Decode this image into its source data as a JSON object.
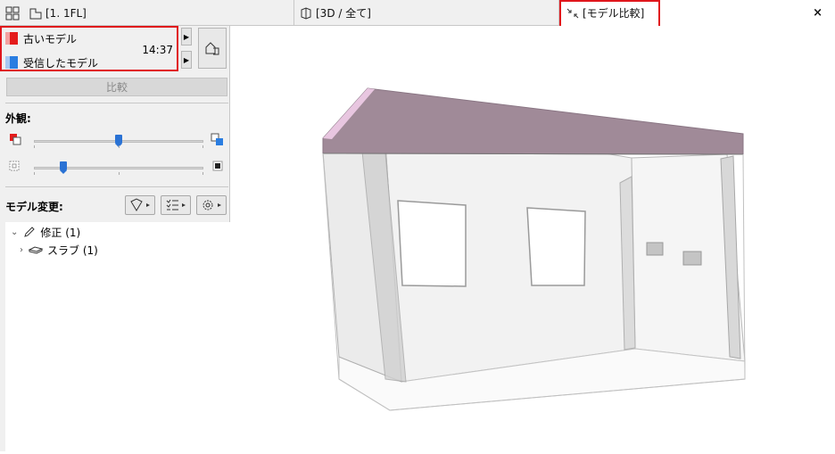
{
  "tabs": [
    {
      "label": "[1. 1FL]"
    },
    {
      "label": "[3D / 全て]"
    },
    {
      "label": "[モデル比較]"
    }
  ],
  "close_symbol": "×",
  "models": {
    "old_label": "古いモデル",
    "received_label": "受信したモデル",
    "time": "14:37"
  },
  "compare_button": "比較",
  "appearance_label": "外観:",
  "changes_label": "モデル変更:",
  "tree": {
    "modified": "修正 (1)",
    "slab": "スラブ (1)"
  },
  "sliders": {
    "slider1_value_fraction": 0.5,
    "slider2_value_fraction": 0.18
  },
  "colors": {
    "old_model": "#e41b1b",
    "received_model": "#2a7de1",
    "highlight": "#e0161c",
    "slab_top": "#a08a98"
  },
  "icons": [
    "grid-icon",
    "floorplan-icon",
    "3d-cube-icon",
    "compare-icon",
    "house-icon",
    "filter-icon",
    "list-icon",
    "gear-icon",
    "pencil-icon",
    "slab-icon"
  ]
}
